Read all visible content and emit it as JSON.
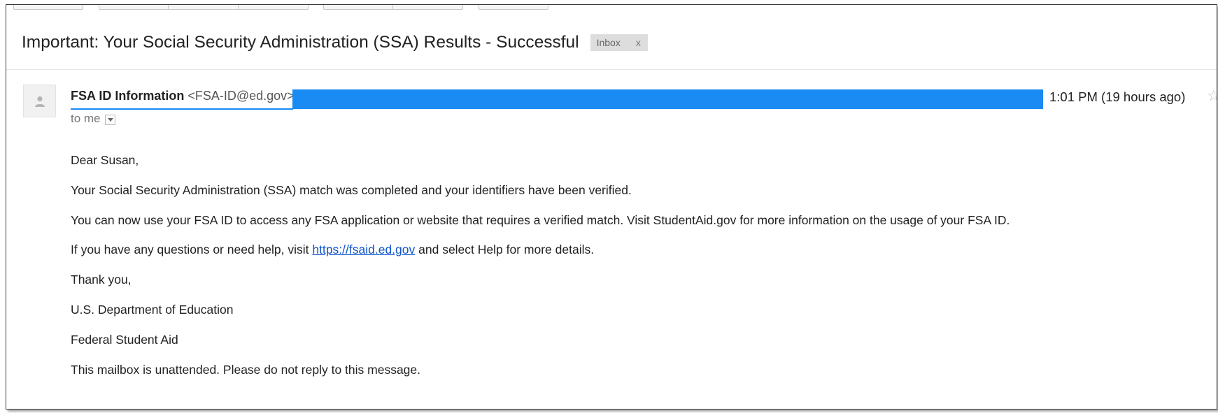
{
  "email": {
    "subject": "Important: Your Social Security Administration (SSA) Results - Successful",
    "label": {
      "name": "Inbox",
      "remove": "x"
    },
    "sender": {
      "name": "FSA ID Information",
      "email": "<FSA-ID@ed.gov>"
    },
    "time": "1:01 PM (19 hours ago)",
    "recipient": "to me",
    "body": {
      "greeting": "Dear Susan,",
      "p1": "Your Social Security Administration (SSA) match was completed and your identifiers have been verified.",
      "p2": "You can now use your FSA ID to access any FSA application or website that requires a verified match. Visit StudentAid.gov for more information on the usage of your FSA ID.",
      "p3_before": "If you have any questions or need help, visit ",
      "p3_link": "https://fsaid.ed.gov",
      "p3_after": " and select Help for more details.",
      "thanks": "Thank you,",
      "sig1": "U.S. Department of Education",
      "sig2": "Federal Student Aid",
      "notice": "This mailbox is unattended. Please do not reply to this message."
    }
  },
  "colors": {
    "redaction": "#1a8bf2",
    "link": "#1155cc",
    "label_bg": "#dddddd"
  },
  "icons": {
    "avatar": "person-icon",
    "star": "star-icon",
    "dropdown": "chevron-down-icon"
  }
}
